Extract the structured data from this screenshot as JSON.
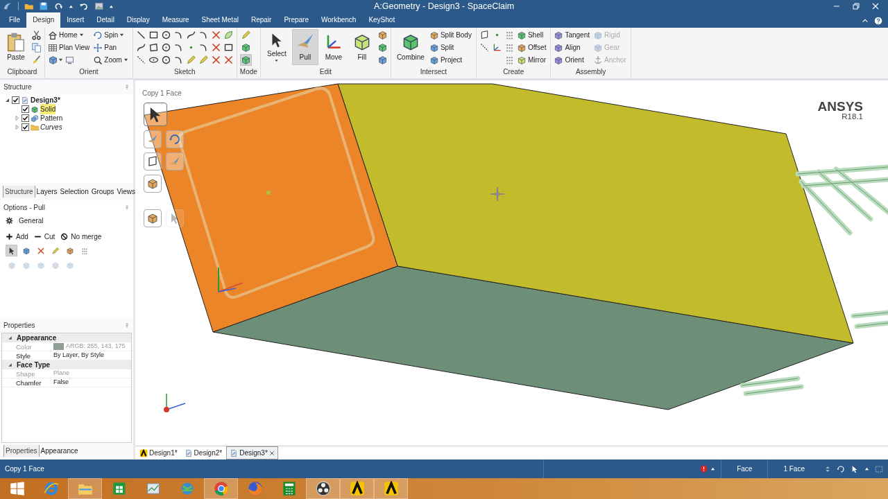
{
  "window": {
    "title": "A:Geometry - Design3 - SpaceClaim"
  },
  "ribbon_tabs": [
    {
      "label": "File",
      "selected": false
    },
    {
      "label": "Design",
      "selected": true
    },
    {
      "label": "Insert",
      "selected": false
    },
    {
      "label": "Detail",
      "selected": false
    },
    {
      "label": "Display",
      "selected": false
    },
    {
      "label": "Measure",
      "selected": false
    },
    {
      "label": "Sheet Metal",
      "selected": false
    },
    {
      "label": "Repair",
      "selected": false
    },
    {
      "label": "Prepare",
      "selected": false
    },
    {
      "label": "Workbench",
      "selected": false
    },
    {
      "label": "KeyShot",
      "selected": false
    }
  ],
  "ribbon_groups": [
    {
      "label": "Clipboard",
      "columns": [
        [
          {
            "kind": "large",
            "label": "Paste"
          }
        ],
        [
          {
            "kind": "icon"
          },
          {
            "kind": "icon"
          },
          {
            "kind": "icon"
          }
        ]
      ]
    },
    {
      "label": "Orient",
      "columns": [
        [
          {
            "kind": "small",
            "label": "Home",
            "dropdown": true
          },
          {
            "kind": "small",
            "label": "Plan View"
          },
          [
            {
              "kind": "icon",
              "dropdown": true
            },
            {
              "kind": "icon"
            }
          ]
        ],
        [
          {
            "kind": "small",
            "label": "Spin",
            "dropdown": true
          },
          {
            "kind": "small",
            "label": "Pan"
          },
          {
            "kind": "small",
            "label": "Zoom",
            "dropdown": true
          }
        ]
      ]
    },
    {
      "label": "Sketch",
      "columns": [
        [
          {
            "kind": "icon"
          },
          {
            "kind": "icon"
          },
          {
            "kind": "icon"
          }
        ],
        [
          {
            "kind": "icon"
          },
          {
            "kind": "icon"
          },
          {
            "kind": "icon"
          }
        ],
        [
          {
            "kind": "icon"
          },
          {
            "kind": "icon"
          },
          {
            "kind": "icon"
          }
        ],
        [
          {
            "kind": "icon"
          },
          {
            "kind": "icon"
          },
          {
            "kind": "icon"
          }
        ],
        [
          {
            "kind": "icon"
          },
          {
            "kind": "icon"
          },
          {
            "kind": "icon"
          }
        ],
        [
          {
            "kind": "icon"
          },
          {
            "kind": "icon"
          },
          {
            "kind": "icon"
          }
        ],
        [
          {
            "kind": "icon"
          },
          {
            "kind": "icon"
          },
          {
            "kind": "icon"
          }
        ],
        [
          {
            "kind": "icon"
          },
          {
            "kind": "icon"
          },
          {
            "kind": "icon"
          }
        ]
      ]
    },
    {
      "label": "Mode",
      "columns": [
        [
          {
            "kind": "icon",
            "selected": false
          },
          {
            "kind": "icon",
            "selected": false
          },
          {
            "kind": "icon",
            "selected": true
          }
        ]
      ]
    },
    {
      "label": "Edit",
      "columns": [
        [
          {
            "kind": "large",
            "label": "Select",
            "dropdown": true,
            "selected": false
          }
        ],
        [
          {
            "kind": "large",
            "label": "Pull",
            "selected": true
          }
        ],
        [
          {
            "kind": "large",
            "label": "Move",
            "selected": false
          }
        ],
        [
          {
            "kind": "large",
            "label": "Fill",
            "selected": false
          }
        ],
        [
          {
            "kind": "icon"
          },
          {
            "kind": "icon"
          },
          {
            "kind": "icon"
          }
        ]
      ]
    },
    {
      "label": "Intersect",
      "columns": [
        [
          {
            "kind": "large",
            "label": "Combine"
          }
        ],
        [
          {
            "kind": "small",
            "label": "Split Body"
          },
          {
            "kind": "small",
            "label": "Split"
          },
          {
            "kind": "small",
            "label": "Project"
          }
        ]
      ]
    },
    {
      "label": "Create",
      "columns": [
        [
          {
            "kind": "icon"
          },
          {
            "kind": "icon"
          }
        ],
        [
          {
            "kind": "icon"
          },
          {
            "kind": "icon"
          }
        ],
        [
          {
            "kind": "icon"
          },
          {
            "kind": "icon"
          },
          {
            "kind": "icon"
          }
        ],
        [
          {
            "kind": "small",
            "label": "Shell"
          },
          {
            "kind": "small",
            "label": "Offset"
          },
          {
            "kind": "small",
            "label": "Mirror"
          }
        ]
      ]
    },
    {
      "label": "Assembly",
      "columns": [
        [
          {
            "kind": "small",
            "label": "Tangent",
            "disabled": false
          },
          {
            "kind": "small",
            "label": "Align",
            "disabled": false
          },
          {
            "kind": "small",
            "label": "Orient",
            "disabled": false
          }
        ],
        [
          {
            "kind": "small",
            "label": "Rigid",
            "disabled": true
          },
          {
            "kind": "small",
            "label": "Gear",
            "disabled": true
          },
          {
            "kind": "small",
            "label": "Anchor",
            "disabled": true
          }
        ]
      ]
    }
  ],
  "structure": {
    "title": "Structure",
    "tree": [
      {
        "label": "Design3*",
        "kind": "design",
        "checked": true,
        "expanded": true,
        "selected": false,
        "italic": false,
        "children": [
          {
            "label": "Solid",
            "kind": "solid",
            "checked": true,
            "selected": true,
            "italic": false
          },
          {
            "label": "Pattern",
            "kind": "pattern",
            "checked": true,
            "expanded": false,
            "selected": false,
            "italic": false
          },
          {
            "label": "Curves",
            "kind": "folder",
            "checked": true,
            "expanded": false,
            "selected": false,
            "italic": true
          }
        ]
      }
    ]
  },
  "panel_tabs": [
    {
      "label": "Structure",
      "selected": true
    },
    {
      "label": "Layers",
      "selected": false
    },
    {
      "label": "Selection",
      "selected": false
    },
    {
      "label": "Groups",
      "selected": false
    },
    {
      "label": "Views",
      "selected": false
    }
  ],
  "options": {
    "title": "Options - Pull",
    "section": "General",
    "actions": [
      {
        "label": "Add",
        "kind": "add"
      },
      {
        "label": "Cut",
        "kind": "cut"
      },
      {
        "label": "No merge",
        "kind": "nomerge"
      }
    ],
    "tool_rows": [
      [
        {
          "selected": true,
          "disabled": false
        },
        {
          "selected": false,
          "disabled": false
        },
        {
          "selected": false,
          "disabled": false
        },
        {
          "selected": false,
          "disabled": false
        },
        {
          "selected": false,
          "disabled": false
        },
        {
          "selected": false,
          "disabled": false
        }
      ],
      [
        {
          "selected": false,
          "disabled": true
        },
        {
          "selected": false,
          "disabled": true
        },
        {
          "selected": false,
          "disabled": true
        },
        {
          "selected": false,
          "disabled": true
        },
        {
          "selected": false,
          "disabled": true
        }
      ]
    ]
  },
  "properties": {
    "title": "Properties",
    "sections": [
      {
        "label": "Appearance",
        "expanded": true,
        "rows": [
          {
            "name": "Color",
            "value": "ARGB: 255, 143, 175",
            "disabled": true,
            "color": "#8f9f93"
          },
          {
            "name": "Style",
            "value": "By Layer, By Style",
            "disabled": false
          }
        ]
      },
      {
        "label": "Face Type",
        "expanded": true,
        "rows": [
          {
            "name": "Shape",
            "value": "Plane",
            "disabled": true
          },
          {
            "name": "Chamfer",
            "value": "False",
            "disabled": false
          }
        ]
      }
    ]
  },
  "property_tabs": [
    {
      "label": "Properties",
      "selected": true
    },
    {
      "label": "Appearance",
      "selected": false
    }
  ],
  "viewport": {
    "caption": "Copy 1 Face",
    "logo": {
      "name": "ANSYS",
      "version": "R18.1"
    },
    "tool_guides": [
      {
        "selected": true,
        "disabled": false
      },
      {
        "selected": false,
        "disabled": false
      },
      {
        "selected": false,
        "disabled": false
      },
      {
        "selected": false,
        "disabled": false
      },
      {
        "selected": false,
        "disabled": false
      },
      {
        "selected": false,
        "disabled": false
      },
      {
        "selected": false,
        "disabled": false
      },
      {
        "selected": false,
        "disabled": true
      }
    ]
  },
  "document_tabs": [
    {
      "label": "Design1*",
      "kind": "ansys",
      "selected": false
    },
    {
      "label": "Design2*",
      "kind": "design",
      "selected": false
    },
    {
      "label": "Design3*",
      "kind": "design",
      "selected": true
    }
  ],
  "status_bar": {
    "message": "Copy 1 Face",
    "selection_filter": "Face",
    "selection_count": "1 Face"
  },
  "taskbar": [
    {
      "running": false
    },
    {
      "running": false
    },
    {
      "running": true
    },
    {
      "running": false
    },
    {
      "running": false
    },
    {
      "running": false
    },
    {
      "running": true
    },
    {
      "running": false
    },
    {
      "running": false
    },
    {
      "running": true
    },
    {
      "running": true
    },
    {
      "running": true
    }
  ]
}
